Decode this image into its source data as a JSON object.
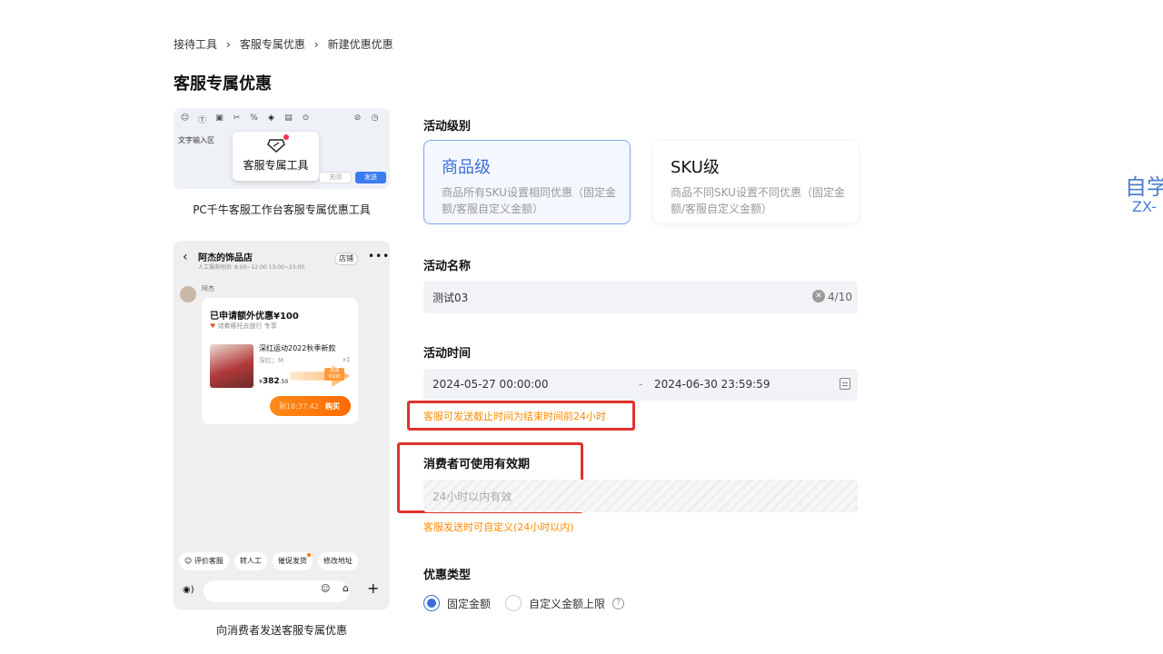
{
  "breadcrumb": [
    "接待工具",
    "客服专属优惠",
    "新建优惠优惠"
  ],
  "page_title": "客服专属优惠",
  "pc_preview": {
    "input_label": "文字输入区",
    "popover_label": "客服专属工具",
    "close_label": "关闭",
    "send_label": "发送",
    "caption": "PC千牛客服工作台客服专属优惠工具"
  },
  "phone_preview": {
    "shop_name": "阿杰的饰品店",
    "hours": "人工服务时间: 8:00~12:00 13:00~23:00",
    "store_button": "店铺",
    "sender": "阿杰",
    "bubble_title": "已申请额外优惠¥100",
    "bubble_sub": "诗肴瘆托去旅行 专享",
    "product_name": "深红运动2022秋季新款",
    "product_spec": "深红；M",
    "product_qty": "x1",
    "price_symbol": "¥",
    "price": "382",
    "price_decimal": ".50",
    "price_tag": "再减¥100",
    "timer": "剩18:37:42",
    "buy_label": "购买",
    "quick_actions": [
      "评价客服",
      "转人工",
      "催促发货",
      "修改地址"
    ],
    "caption": "向消费者发送客服专属优惠"
  },
  "form": {
    "level_label": "活动级别",
    "levels": [
      {
        "title": "商品级",
        "desc": "商品所有SKU设置相同优惠（固定金额/客服自定义金额）"
      },
      {
        "title": "SKU级",
        "desc": "商品不同SKU设置不同优惠（固定金额/客服自定义金额）"
      }
    ],
    "selected_level": "商品级",
    "name_label": "活动名称",
    "name_value": "测试03",
    "name_count": "4/10",
    "time_label": "活动时间",
    "start_time": "2024-05-27 00:00:00",
    "time_separator": "-",
    "end_time": "2024-06-30 23:59:59",
    "time_hint": "客服可发送截止时间为结束时间前24小时",
    "validity_label": "消费者可使用有效期",
    "validity_placeholder": "24小时以内有效",
    "validity_hint": "客服发送时可自定义(24小时以内)",
    "discount_type_label": "优惠类型",
    "discount_types": [
      "固定金额",
      "自定义金额上限"
    ],
    "selected_discount_type": "固定金额"
  },
  "watermark": {
    "line1": "自学",
    "line2": "ZX-"
  },
  "colors": {
    "accent": "#3a6fd8",
    "warning": "#ff8a00",
    "highlight_box": "#e0332c",
    "buy_button": "#ff6a00"
  }
}
